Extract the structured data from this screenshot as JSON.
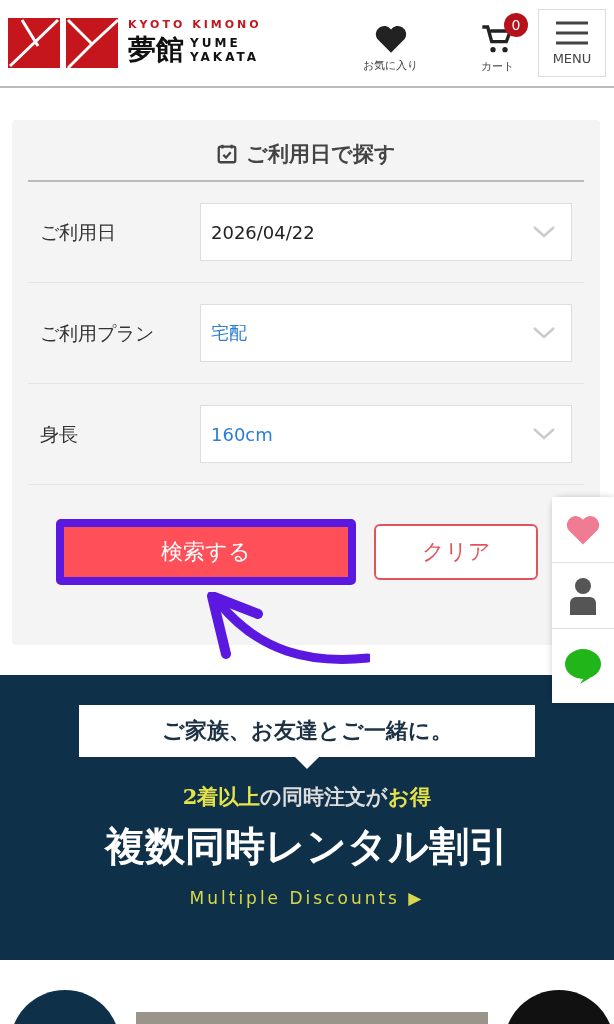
{
  "header": {
    "logo": {
      "tagline": "KYOTO KIMONO",
      "name": "夢館",
      "roman_top": "YUME",
      "roman_bottom": "YAKATA"
    },
    "favorites": {
      "label": "お気に入り"
    },
    "cart": {
      "label": "カート",
      "count": "0"
    },
    "menu": {
      "label": "MENU"
    }
  },
  "search": {
    "title": "ご利用日で探す",
    "fields": [
      {
        "label": "ご利用日",
        "value": "2026/04/22",
        "filled": false
      },
      {
        "label": "ご利用プラン",
        "value": "宅配",
        "filled": true
      },
      {
        "label": "身長",
        "value": "160cm",
        "filled": true
      }
    ],
    "search_button": {
      "label": "検索する",
      "highlighted": true
    },
    "clear_button": {
      "label": "クリア"
    }
  },
  "banner": {
    "speech": "ご家族、お友達とご一緒に。",
    "lead": "**2着以上**の同時注文が**お得**",
    "title": "複数同時レンタル割引",
    "link": "Multiple Discounts ▶"
  }
}
